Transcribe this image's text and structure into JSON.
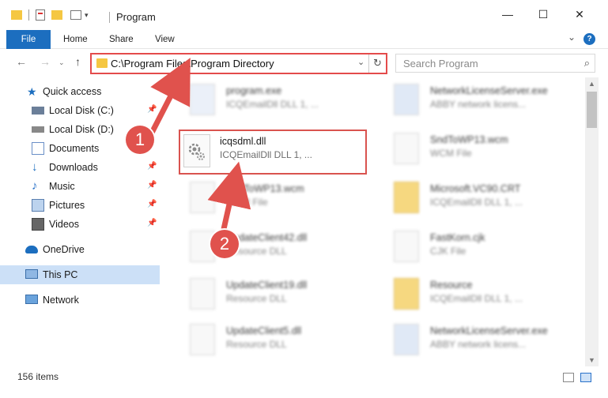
{
  "window": {
    "title": "Program",
    "minimize": "—",
    "maximize": "☐",
    "close": "✕",
    "expand_ribbon": "⌄",
    "help": "?"
  },
  "ribbon": {
    "tabs": [
      "File",
      "Home",
      "Share",
      "View"
    ]
  },
  "address_bar": {
    "path": "C:\\Program Files\\Program Directory",
    "dropdown": "⌄",
    "refresh": "↻"
  },
  "search": {
    "placeholder": "Search Program",
    "icon": "⌕"
  },
  "nav_pane": {
    "items": [
      {
        "label": "Quick access",
        "icon": "star-icon"
      },
      {
        "label": "Local Disk (C:)",
        "icon": "drive-icon"
      },
      {
        "label": "Local Disk (D:)",
        "icon": "drive-icon"
      },
      {
        "label": "Documents",
        "icon": "documents-icon"
      },
      {
        "label": "Downloads",
        "icon": "download-icon"
      },
      {
        "label": "Music",
        "icon": "music-icon"
      },
      {
        "label": "Pictures",
        "icon": "pictures-icon"
      },
      {
        "label": "Videos",
        "icon": "videos-icon"
      },
      {
        "label": "OneDrive",
        "icon": "onedrive-icon"
      },
      {
        "label": "This PC",
        "icon": "pc-icon"
      },
      {
        "label": "Network",
        "icon": "network-icon"
      }
    ]
  },
  "files": {
    "left": [
      {
        "name": "program.exe",
        "desc": "ICQEmailDll DLL 1, ..."
      },
      {
        "name": "icqsdml.dll",
        "desc": "ICQEmailDll DLL 1, ..."
      },
      {
        "name": "SndToWP13.wcm",
        "desc": "WCM File"
      },
      {
        "name": "UpdateClient42.dll",
        "desc": "Resource DLL"
      },
      {
        "name": "UpdateClient19.dll",
        "desc": "Resource DLL"
      },
      {
        "name": "UpdateClient5.dll",
        "desc": "Resource DLL"
      }
    ],
    "right": [
      {
        "name": "NetworkLicenseServer.exe",
        "desc": "ABBY network licens..."
      },
      {
        "name": "SndToWP13.wcm",
        "desc": "WCM File"
      },
      {
        "name": "Microsoft.VC90.CRT",
        "desc": "ICQEmailDll DLL 1, ..."
      },
      {
        "name": "FastKorn.cjk",
        "desc": "CJK File"
      },
      {
        "name": "Resource",
        "desc": "ICQEmailDll DLL 1, ..."
      },
      {
        "name": "NetworkLicenseServer.exe",
        "desc": "ABBY network licens..."
      }
    ]
  },
  "annotations": {
    "step1": "1",
    "step2": "2"
  },
  "status": {
    "item_count": "156 items"
  },
  "colors": {
    "accent": "#1c6ebf",
    "highlight": "#e0524d",
    "selected": "#cce0f7"
  }
}
